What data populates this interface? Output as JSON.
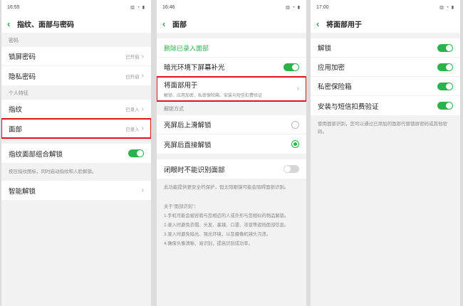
{
  "screen1": {
    "status": {
      "time": "16:55",
      "icons": "▥ ◔ ▮"
    },
    "title": "指纹、面部与密码",
    "section_password": "密码",
    "lock_password": {
      "label": "锁屏密码",
      "status": "已开启"
    },
    "privacy_password": {
      "label": "隐私密码",
      "status": "已开启"
    },
    "section_personal": "个人特征",
    "fingerprint": {
      "label": "指纹",
      "status": "已录入"
    },
    "face": {
      "label": "面部",
      "status": "已录入"
    },
    "combo_unlock": {
      "label": "指纹面部组合解锁",
      "on": true
    },
    "combo_note": "按压指纹图标，同时启动指纹和人脸解锁。",
    "smart_unlock": {
      "label": "智能解锁"
    }
  },
  "screen2": {
    "status": {
      "time": "16:46",
      "icons": "▥ ◔ ▮"
    },
    "title": "面部",
    "delete_face": "删除已录入面部",
    "dim_fill": {
      "label": "暗光环境下屏幕补光",
      "on": true
    },
    "use_face_for": {
      "label": "将面部用于",
      "sub": "解锁、应用加密、私密保险箱、安装与短信扣费验证"
    },
    "section_unlock_mode": "解锁方式",
    "swipe_unlock": {
      "label": "亮屏后上滑解锁",
      "selected": false
    },
    "direct_unlock": {
      "label": "亮屏后直接解锁",
      "selected": true
    },
    "eyes_closed": {
      "label": "闭眼时不能识别面部",
      "on": false
    },
    "eyes_note": "此功能提供更安全的保护，但太阳眼镜可能会阻碍面部识别。",
    "about_title": "关于“面部识别”：",
    "about_items": [
      "1.手机可能会被容貌与您相近的人或外形与您相似的物品解锁。",
      "2.录入时避免衣帽、头发、墨镜、口罩、浓妆等遮挡面部信息。",
      "3.录入时避免暗光、强光环境，以及摄像机镜头污渍。",
      "4.确保头像清晰、易识别，提高识别成功率。"
    ]
  },
  "screen3": {
    "status": {
      "time": "17:00",
      "icons": "▥ ◔ ▮"
    },
    "title": "将面部用于",
    "items": [
      {
        "label": "解锁",
        "on": true
      },
      {
        "label": "应用加密",
        "on": true
      },
      {
        "label": "私密保险箱",
        "on": true
      },
      {
        "label": "安装与短信扣费验证",
        "on": true
      }
    ],
    "note": "使用面部识别，您可以通过已添加的面部代替锁屏密码或其他密码。"
  },
  "colors": {
    "accent": "#2bb24c",
    "highlight": "#e0141e"
  }
}
